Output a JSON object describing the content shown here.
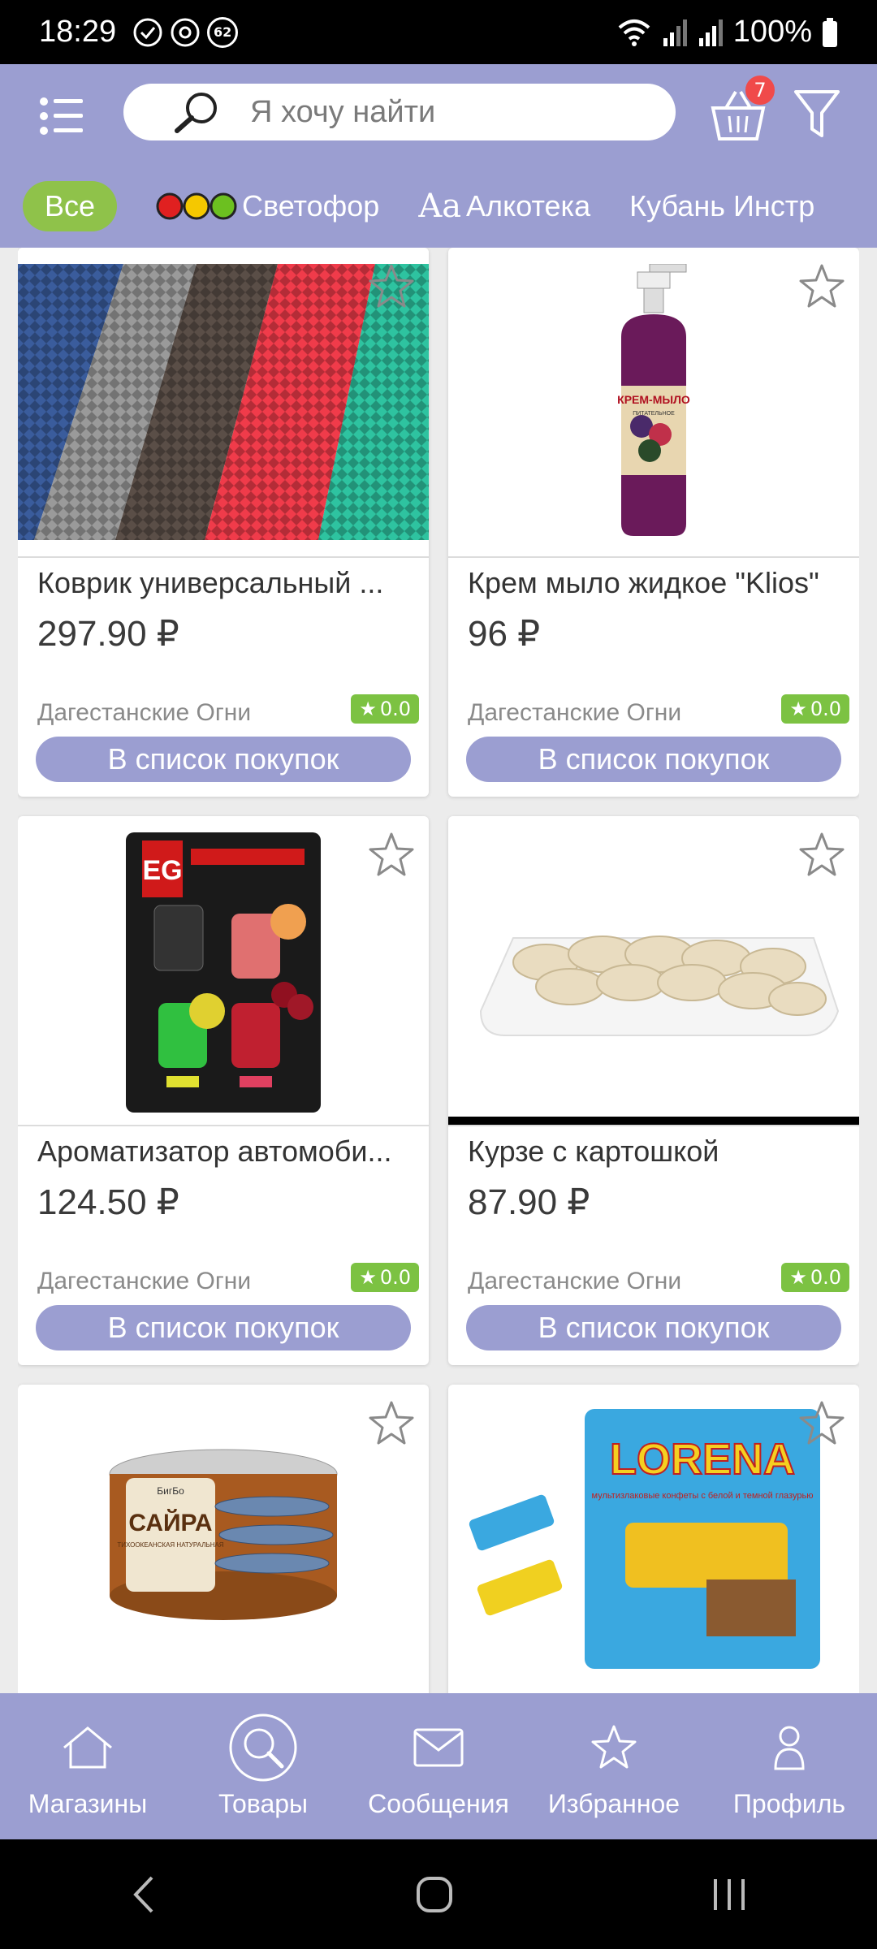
{
  "status_bar": {
    "time": "18:29",
    "notification_count": "62",
    "battery": "100%"
  },
  "header": {
    "search_placeholder": "Я хочу найти",
    "cart_badge": "7",
    "bg_color": "#9b9ed1"
  },
  "chips": [
    {
      "label": "Все",
      "active": true
    },
    {
      "label": "Светофор",
      "icon": "traffic-light-icon"
    },
    {
      "label": "Алкотека",
      "icon": "aa-icon",
      "icon_text": "Aa"
    },
    {
      "label": "Кубань Инстр",
      "icon": null
    }
  ],
  "products": [
    {
      "name": "Коврик универсальный ...",
      "price": "297.90 ₽",
      "store": "Дагестанские Огни",
      "rating": "0.0",
      "button": "В список покупок"
    },
    {
      "name": "Крем мыло жидкое \"Klios\"",
      "price": "96 ₽",
      "store": "Дагестанские Огни",
      "rating": "0.0",
      "button": "В список покупок"
    },
    {
      "name": "Ароматизатор автомоби...",
      "price": "124.50 ₽",
      "store": "Дагестанские Огни",
      "rating": "0.0",
      "button": "В список покупок"
    },
    {
      "name": "Курзе с картошкой",
      "price": "87.90 ₽",
      "store": "Дагестанские Огни",
      "rating": "0.0",
      "button": "В список покупок"
    },
    {
      "name": "",
      "price": "",
      "store": "",
      "rating": "",
      "button": ""
    },
    {
      "name": "",
      "price": "",
      "store": "",
      "rating": "",
      "button": ""
    }
  ],
  "image_text": {
    "soap_label": "КРЕМ-МЫЛО",
    "soap_sublabel": "ПИТАТЕЛЬНОЕ",
    "freshener_logo": "EG",
    "fish_brand": "БигБо",
    "fish_title": "САЙРА",
    "fish_sub": "ТИХООКЕАНСКАЯ НАТУРАЛЬНАЯ",
    "candy_brand": "LORENA",
    "candy_sub": "мультизлаковые конфеты с белой и темной глазурью"
  },
  "bottom_nav": [
    {
      "label": "Магазины",
      "icon": "home-icon"
    },
    {
      "label": "Товары",
      "icon": "search-icon"
    },
    {
      "label": "Сообщения",
      "icon": "envelope-icon"
    },
    {
      "label": "Избранное",
      "icon": "star-icon"
    },
    {
      "label": "Профиль",
      "icon": "person-icon"
    }
  ]
}
